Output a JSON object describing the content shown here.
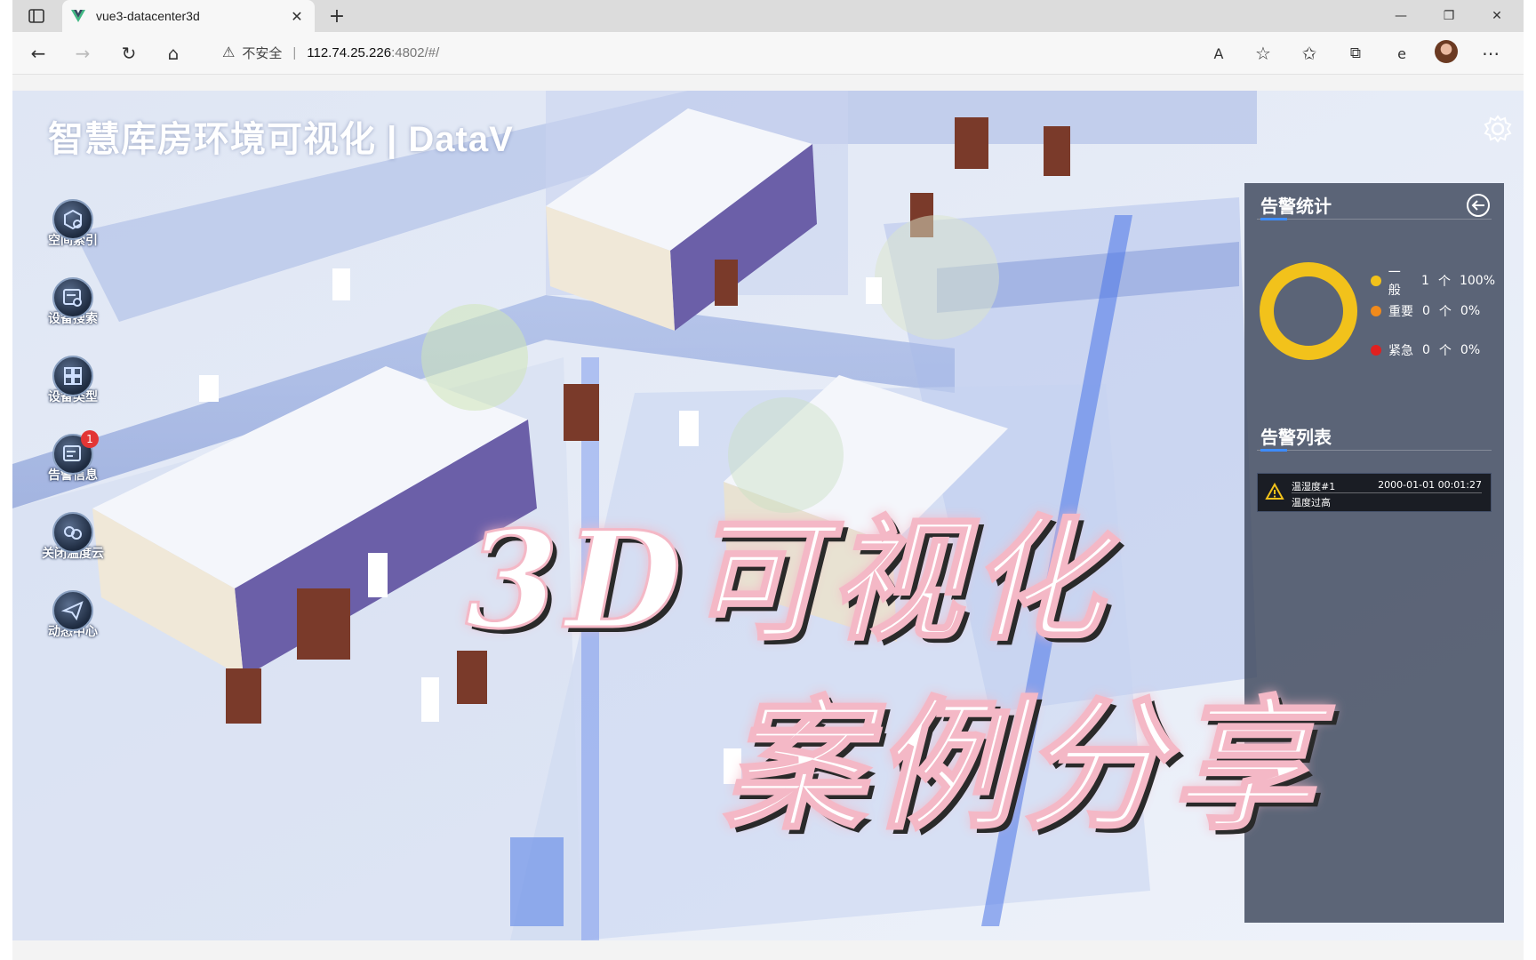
{
  "browser": {
    "tab_title": "vue3-datacenter3d",
    "security_label": "不安全",
    "url_host": "112.74.25.226",
    "url_rest": ":4802/#/"
  },
  "app": {
    "title": "智慧库房环境可视化 | DataV"
  },
  "menu": [
    {
      "label": "空间索引",
      "icon": "cube-search-icon"
    },
    {
      "label": "设备搜索",
      "icon": "device-search-icon"
    },
    {
      "label": "设备类型",
      "icon": "device-type-icon"
    },
    {
      "label": "告警信息",
      "icon": "alarm-info-icon",
      "badge": "1"
    },
    {
      "label": "关闭温度云",
      "icon": "temperature-cloud-icon"
    },
    {
      "label": "动态中心",
      "icon": "paper-plane-icon"
    }
  ],
  "alarm_panel": {
    "stats_title": "告警统计",
    "list_title": "告警列表",
    "legend": [
      {
        "name": "一般",
        "count": "1",
        "unit": "个",
        "percent": "100%",
        "color": "#f2c21b"
      },
      {
        "name": "重要",
        "count": "0",
        "unit": "个",
        "percent": "0%",
        "color": "#f08a1c"
      },
      {
        "name": "紧急",
        "count": "0",
        "unit": "个",
        "percent": "0%",
        "color": "#e02020"
      }
    ],
    "alarm_item": {
      "name": "温湿度#1",
      "time": "2000-01-01 00:01:27",
      "desc": "温度过高"
    }
  },
  "overlay": {
    "line1": "3D可视化",
    "line2": "案例分享"
  },
  "colors": {
    "ring": "#f2c21b",
    "accent": "#3d8cff",
    "caption_outline": "#f4b8c6"
  }
}
